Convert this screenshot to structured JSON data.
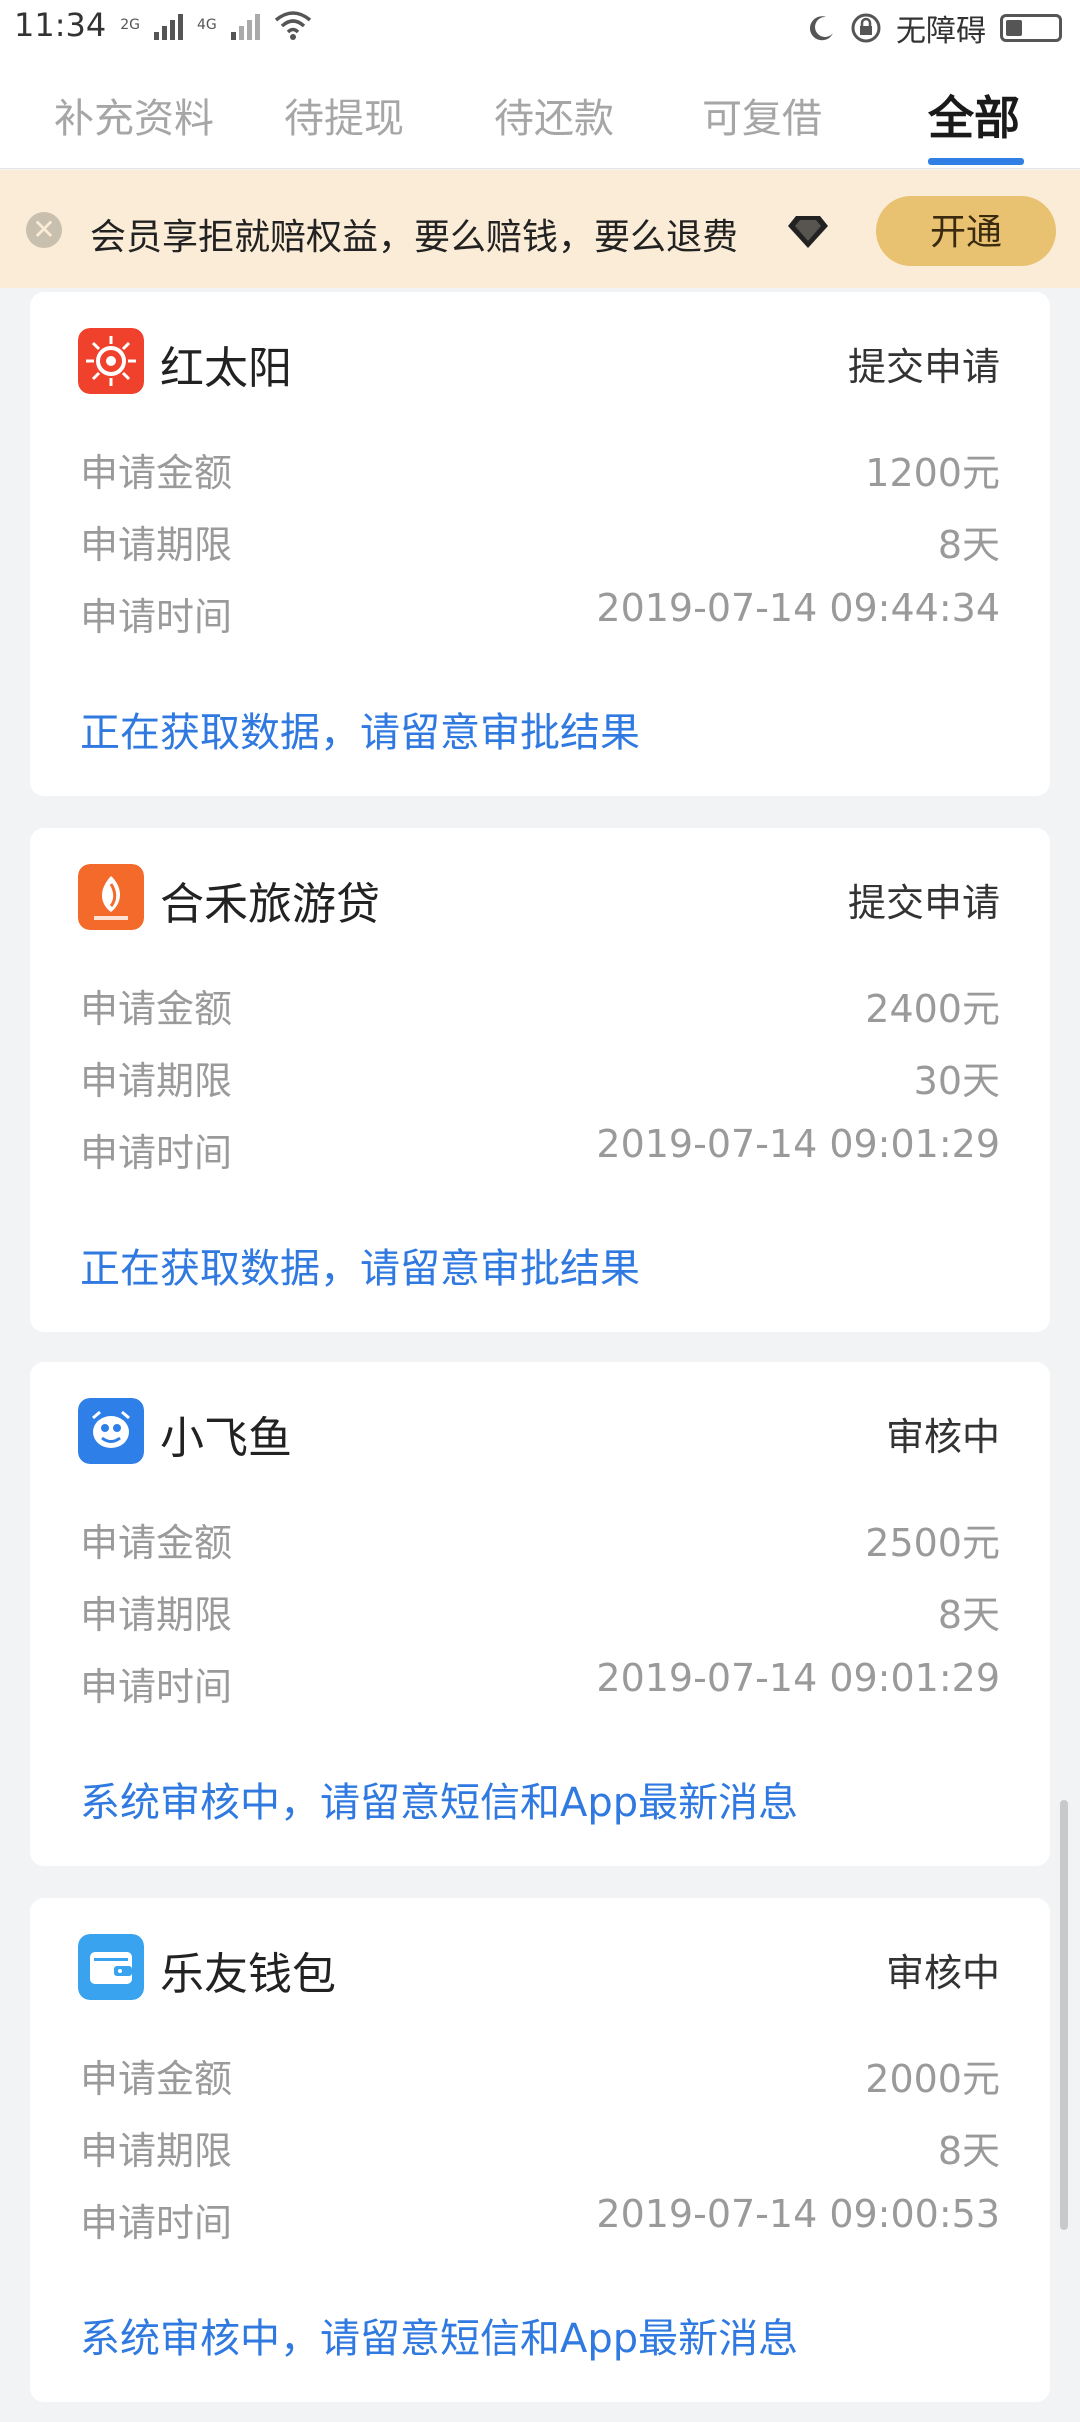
{
  "status_bar": {
    "time": "11:34",
    "net1": "2G",
    "net2": "4G",
    "accessibility": "无障碍",
    "icons": [
      "signal-icon",
      "wifi-icon",
      "moon-icon",
      "lock-rotation-icon",
      "battery-icon"
    ]
  },
  "tabs": [
    {
      "label": "补充资料",
      "active": false
    },
    {
      "label": "待提现",
      "active": false
    },
    {
      "label": "待还款",
      "active": false
    },
    {
      "label": "可复借",
      "active": false
    },
    {
      "label": "全部",
      "active": true
    }
  ],
  "banner": {
    "text": "会员享拒就赔权益，要么赔钱，要么退费",
    "button": "开通",
    "icons": [
      "close-icon",
      "diamond-icon"
    ]
  },
  "labels": {
    "amount": "申请金额",
    "term": "申请期限",
    "time": "申请时间"
  },
  "cards": [
    {
      "name": "红太阳",
      "status": "提交申请",
      "amount": "1200元",
      "term": "8天",
      "time": "2019-07-14 09:44:34",
      "note": "正在获取数据，请留意审批结果",
      "logo_color": "#f0412d",
      "icon": "sun-logo-icon"
    },
    {
      "name": "合禾旅游贷",
      "status": "提交申请",
      "amount": "2400元",
      "term": "30天",
      "time": "2019-07-14 09:01:29",
      "note": "正在获取数据，请留意审批结果",
      "logo_color": "#f36a2b",
      "icon": "hehe-logo-icon"
    },
    {
      "name": "小飞鱼",
      "status": "审核中",
      "amount": "2500元",
      "term": "8天",
      "time": "2019-07-14 09:01:29",
      "note": "系统审核中，请留意短信和App最新消息",
      "logo_color": "#2f7fe8",
      "icon": "fish-logo-icon"
    },
    {
      "name": "乐友钱包",
      "status": "审核中",
      "amount": "2000元",
      "term": "8天",
      "time": "2019-07-14 09:00:53",
      "note": "系统审核中，请留意短信和App最新消息",
      "logo_color": "#3aa3f0",
      "icon": "wallet-logo-icon"
    }
  ],
  "colors": {
    "accent": "#2f7fe4",
    "note": "#2f79e0",
    "banner_bg": "#fbecd7",
    "banner_button": "#e8c270"
  }
}
